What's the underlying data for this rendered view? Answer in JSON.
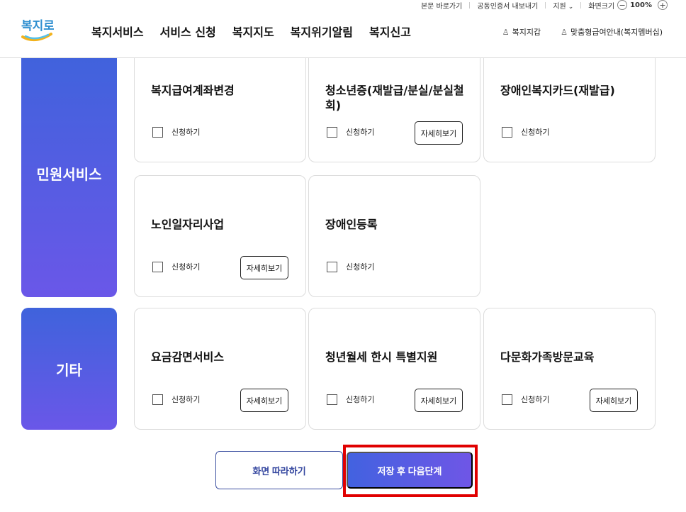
{
  "util": {
    "skip_label": "본문 바로가기",
    "cert_label": "공동인증서 내보내기",
    "support_label": "지원",
    "zoom_label": "화면크기",
    "zoom_value": "100%"
  },
  "logo": {
    "text": "복지로"
  },
  "gnb": [
    "복지서비스",
    "서비스 신청",
    "복지지도",
    "복지위기알림",
    "복지신고"
  ],
  "right_links": {
    "wallet": "복지지갑",
    "membership": "맞춤형급여안내(복지멤버십)"
  },
  "categories": {
    "civil": "민원서비스",
    "etc": "기타"
  },
  "apply_label": "신청하기",
  "detail_label": "자세히보기",
  "cards": [
    {
      "title": "복지급여계좌변경"
    },
    {
      "title": "청소년증(재발급/분실/분실철회)"
    },
    {
      "title": "장애인복지카드(재발급)"
    },
    {
      "title": "노인일자리사업"
    },
    {
      "title": "장애인등록"
    },
    {
      "title": "요금감면서비스"
    },
    {
      "title": "청년월세 한시 특별지원"
    },
    {
      "title": "다문화가족방문교육"
    }
  ],
  "buttons": {
    "follow": "화면 따라하기",
    "next": "저장 후 다음단계"
  }
}
